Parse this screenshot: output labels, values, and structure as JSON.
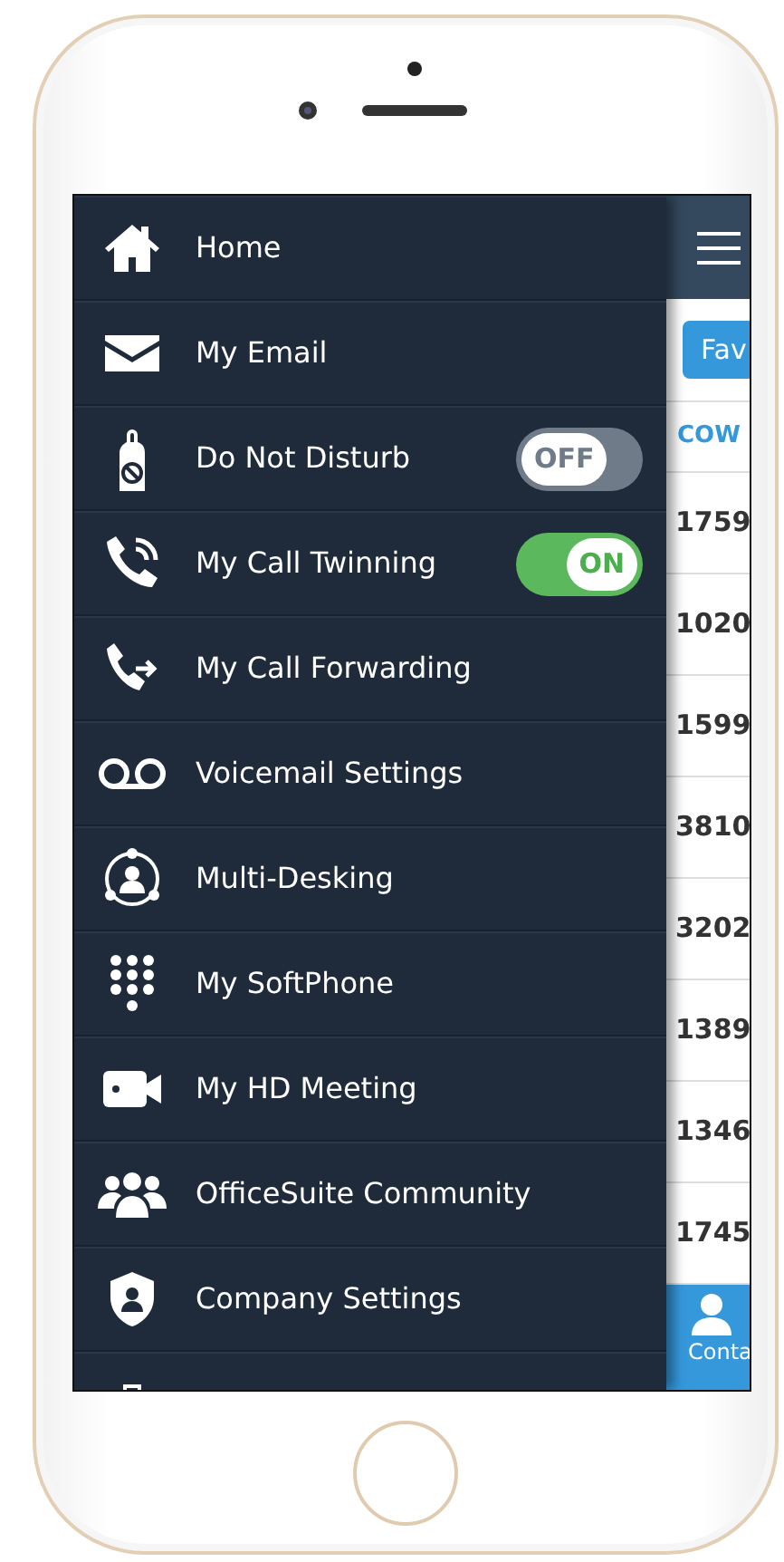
{
  "menu": [
    {
      "label": "Home",
      "kind": "link"
    },
    {
      "label": "My Email",
      "kind": "link"
    },
    {
      "label": "Do Not Disturb",
      "kind": "toggle",
      "on": false,
      "toggle_text": "OFF"
    },
    {
      "label": "My Call Twinning",
      "kind": "toggle",
      "on": true,
      "toggle_text": "ON"
    },
    {
      "label": "My Call Forwarding",
      "kind": "link"
    },
    {
      "label": "Voicemail Settings",
      "kind": "link"
    },
    {
      "label": "Multi-Desking",
      "kind": "link"
    },
    {
      "label": "My SoftPhone",
      "kind": "link"
    },
    {
      "label": "My HD Meeting",
      "kind": "link"
    },
    {
      "label": "OfficeSuite Community",
      "kind": "link"
    },
    {
      "label": "Company Settings",
      "kind": "link"
    },
    {
      "kind": "partial"
    }
  ],
  "behind": {
    "favorites_button": "Fav",
    "column_heading": "COW",
    "rows": [
      "1759",
      "1020",
      "1599",
      "3810",
      "3202",
      "1389",
      "1346",
      "1745"
    ],
    "bottom_tab": "Conta"
  }
}
